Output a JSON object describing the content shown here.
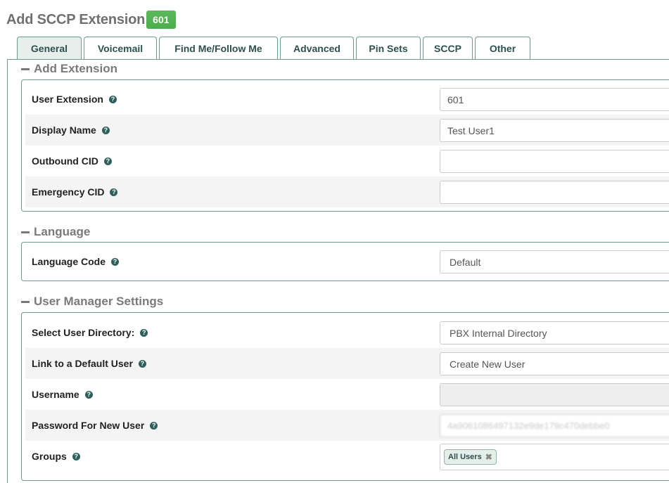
{
  "header": {
    "title": "Add SCCP Extension",
    "extension_badge": "601"
  },
  "tabs": [
    {
      "label": "General",
      "active": true
    },
    {
      "label": "Voicemail"
    },
    {
      "label": "Find Me/Follow Me"
    },
    {
      "label": "Advanced"
    },
    {
      "label": "Pin Sets"
    },
    {
      "label": "SCCP"
    },
    {
      "label": "Other"
    }
  ],
  "sections": {
    "add_extension": {
      "title": "Add Extension",
      "rows": [
        {
          "label": "User Extension",
          "value": "601"
        },
        {
          "label": "Display Name",
          "value": "Test User1"
        },
        {
          "label": "Outbound CID",
          "value": ""
        },
        {
          "label": "Emergency CID",
          "value": ""
        }
      ]
    },
    "language": {
      "title": "Language",
      "rows": [
        {
          "label": "Language Code",
          "value": "Default"
        }
      ]
    },
    "user_manager": {
      "title": "User Manager Settings",
      "rows": [
        {
          "label": "Select User Directory:",
          "value": "PBX Internal Directory"
        },
        {
          "label": "Link to a Default User",
          "value": "Create New User"
        },
        {
          "label": "Username",
          "value": ""
        },
        {
          "label": "Password For New User",
          "value": "4a9061086497132e9de179c470debbe0"
        },
        {
          "label": "Groups",
          "tag": "All Users",
          "tag_remove": "✖"
        }
      ]
    }
  },
  "icons": {
    "help": "?",
    "collapse": "minus-icon"
  },
  "colors": {
    "badge": "#5cb85c",
    "border": "#6f9c8f",
    "help_icon": "#2f5f5c",
    "active_tab": "#e7efec"
  }
}
